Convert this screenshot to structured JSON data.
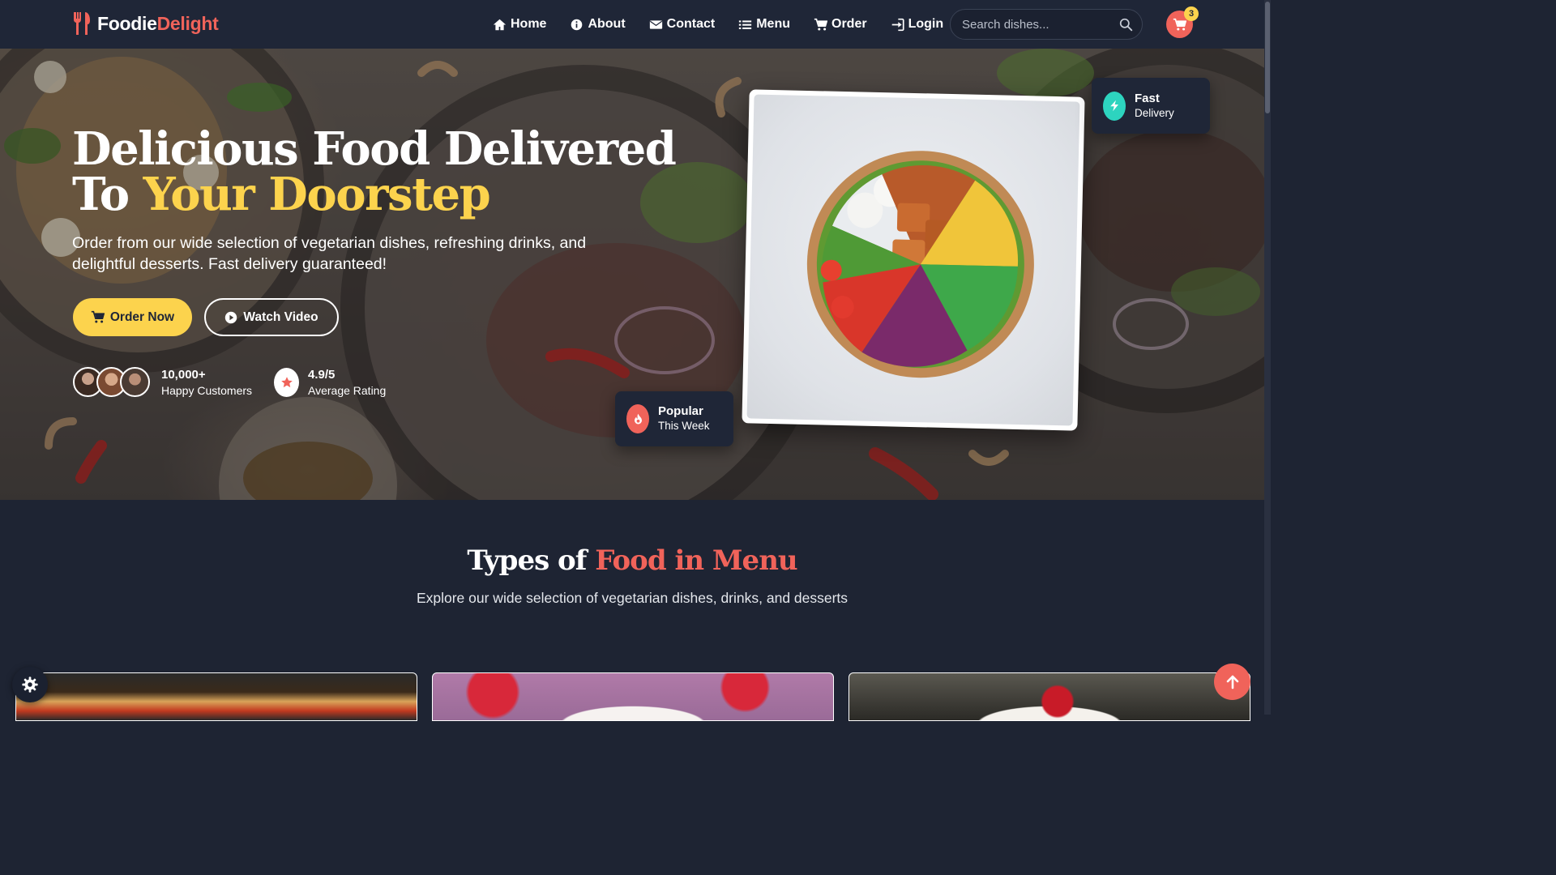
{
  "brand": {
    "name_a": "Foodie",
    "name_b": "Delight"
  },
  "nav": {
    "items": [
      {
        "label": "Home",
        "icon": "home-icon"
      },
      {
        "label": "About",
        "icon": "info-icon"
      },
      {
        "label": "Contact",
        "icon": "envelope-icon"
      },
      {
        "label": "Menu",
        "icon": "list-icon"
      },
      {
        "label": "Order",
        "icon": "cart-icon"
      },
      {
        "label": "Login",
        "icon": "sign-in-icon"
      }
    ]
  },
  "search": {
    "placeholder": "Search dishes..."
  },
  "cart": {
    "count": "3"
  },
  "hero": {
    "title_line1": "Delicious Food Delivered",
    "title_to": "To",
    "title_accent": "Your Doorstep",
    "subtitle": "Order from our wide selection of vegetarian dishes, refreshing drinks, and delightful desserts. Fast delivery guaranteed!",
    "order_button": "Order Now",
    "video_button": "Watch Video",
    "customers_count": "10,000+",
    "customers_label": "Happy Customers",
    "rating_value": "4.9/5",
    "rating_label": "Average Rating",
    "badge_fast_title": "Fast",
    "badge_fast_sub": "Delivery",
    "badge_popular_title": "Popular",
    "badge_popular_sub": "This Week"
  },
  "types_section": {
    "title_a": "Types of",
    "title_b": "Food in Menu",
    "subtitle": "Explore our wide selection of vegetarian dishes, drinks, and desserts"
  },
  "colors": {
    "background": "#1e2433",
    "navbar": "#1f2637",
    "accent_coral": "#f0635a",
    "accent_yellow": "#fcd34d",
    "accent_teal": "#2dd4bf"
  }
}
